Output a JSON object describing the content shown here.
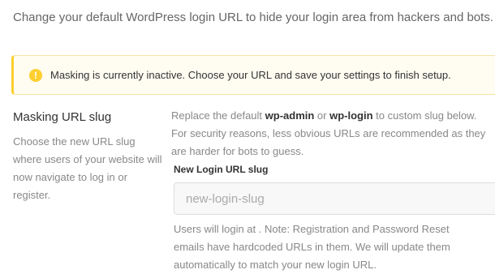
{
  "intro": {
    "text": "Change your default WordPress login URL to hide your login area from hackers and bots."
  },
  "notice": {
    "icon": "exclamation-circle-icon",
    "icon_glyph": "!",
    "text": "Masking is currently inactive. Choose your URL and save your settings to finish setup.",
    "accent_color": "#fecf2f"
  },
  "section": {
    "title": "Masking URL slug",
    "description": "Choose the new URL slug where users of your website will now navigate to log in or register."
  },
  "main": {
    "replace_prefix": "Replace the default ",
    "replace_bold1": "wp-admin",
    "replace_or": " or ",
    "replace_bold2": "wp-login",
    "replace_suffix": " to custom slug below.",
    "security_line1": "For security reasons, less obvious URLs are recommended as they",
    "security_line2": "are harder for bots to guess.",
    "field_label": "New Login URL slug",
    "input_value": "",
    "input_placeholder": "new-login-slug",
    "help_text": "Users will login at . Note: Registration and Password Reset emails have hardcoded URLs in them. We will update them automatically to match your new login URL."
  }
}
